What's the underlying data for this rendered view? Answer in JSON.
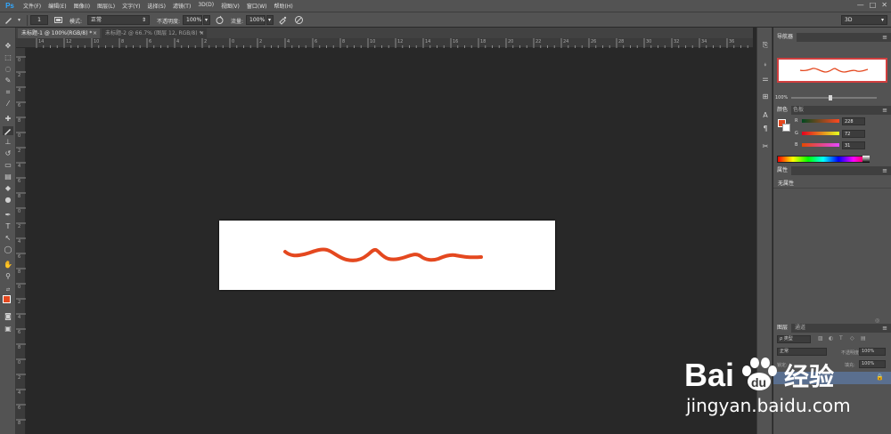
{
  "menubar": {
    "logo": "Ps",
    "items": [
      "文件(F)",
      "编辑(E)",
      "图像(I)",
      "图层(L)",
      "文字(Y)",
      "选择(S)",
      "滤镜(T)",
      "3D(D)",
      "视图(V)",
      "窗口(W)",
      "帮助(H)"
    ],
    "window_controls": [
      "—",
      "□",
      "✕"
    ]
  },
  "options": {
    "brush_size": "1",
    "mode_label": "模式:",
    "mode_value": "正常",
    "opacity_label": "不透明度:",
    "opacity_value": "100%",
    "flow_label": "流量:",
    "flow_value": "100%",
    "workspace": "3D"
  },
  "tabs": [
    {
      "label": "未标题-1 @ 100%(RGB/8) *",
      "close": "×"
    },
    {
      "label": "未标题-2 @ 66.7% (图层 12, RGB/8) *",
      "close": "×"
    }
  ],
  "ruler": {
    "h_numbers": [
      "14",
      "12",
      "10",
      "8",
      "6",
      "4",
      "2",
      "0",
      "2",
      "4",
      "6",
      "8",
      "10",
      "12",
      "14",
      "16",
      "18",
      "20",
      "22",
      "24",
      "26",
      "28",
      "30",
      "32",
      "34",
      "36",
      "38"
    ],
    "v_numbers": [
      "0",
      "2",
      "4",
      "6",
      "8",
      "0",
      "2",
      "4",
      "6",
      "8",
      "0",
      "2",
      "4",
      "6",
      "8",
      "0",
      "2",
      "4",
      "6",
      "8",
      "0",
      "2",
      "4",
      "6",
      "8"
    ]
  },
  "panels": {
    "navigator": {
      "tab": "导航器",
      "zoom": "100%"
    },
    "color": {
      "tabs": [
        "颜色",
        "色板"
      ],
      "r_label": "R",
      "r_value": "228",
      "g_label": "G",
      "g_value": "72",
      "b_label": "B",
      "b_value": "31",
      "foreground": "#e4481f"
    },
    "properties": {
      "tab": "属性",
      "text": "无属性"
    },
    "layers": {
      "tabs": [
        "图层",
        "通道"
      ],
      "filter_label": "ρ 类型",
      "blend_mode": "正常",
      "opacity_label": "不透明度:",
      "opacity_value": "100%",
      "lock_label": "锁定:",
      "fill_label": "填充:",
      "fill_value": "100%"
    }
  },
  "watermark": {
    "logo_text": "Bai",
    "logo_text2": "du",
    "logo_cn": "经验",
    "url": "jingyan.baidu.com"
  },
  "colors": {
    "stroke": "#e4481f",
    "accent": "#31a8ff"
  }
}
